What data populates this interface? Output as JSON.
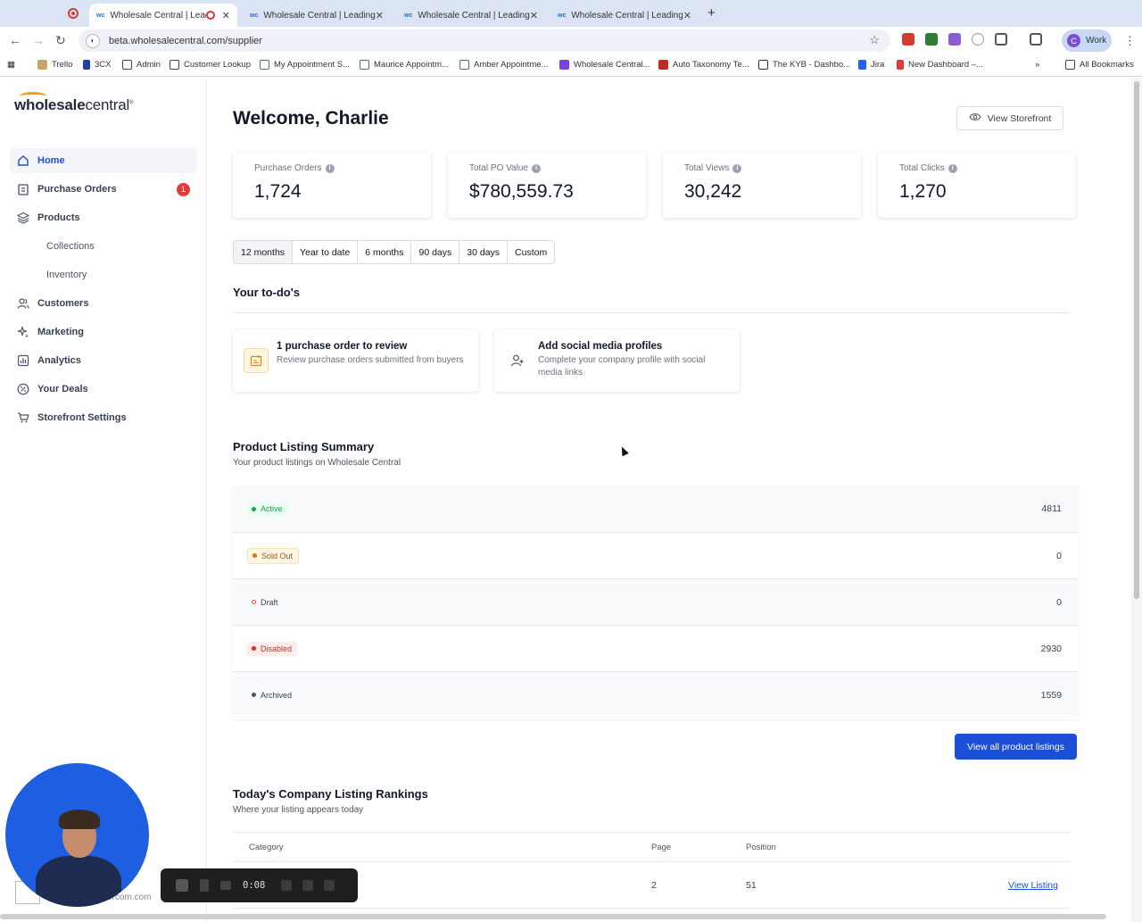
{
  "browser": {
    "tabs": [
      {
        "title": "Wholesale Central | Lead",
        "active": true,
        "recording": true
      },
      {
        "title": "Wholesale Central | Leading",
        "active": false
      },
      {
        "title": "Wholesale Central | Leading",
        "active": false
      },
      {
        "title": "Wholesale Central | Leading",
        "active": false
      }
    ],
    "url": "beta.wholesalecentral.com/supplier",
    "profile_label": "Work",
    "profile_initial": "C",
    "bookmarks": [
      "Trello",
      "3CX",
      "Admin",
      "Customer Lookup",
      "My Appointment S...",
      "Maurice Appointm...",
      "Amber Appointme...",
      "Wholesale Central...",
      "Auto Taxonomy Te...",
      "The KYB - Dashbo...",
      "Jira",
      "New Dashboard –..."
    ],
    "all_bookmarks_label": "All Bookmarks"
  },
  "sidebar": {
    "logo_bold": "wholesale",
    "logo_light": "central",
    "items": [
      {
        "label": "Home",
        "icon": "home-icon",
        "active": true
      },
      {
        "label": "Purchase Orders",
        "icon": "clipboard-icon",
        "badge": "1"
      },
      {
        "label": "Products",
        "icon": "layers-icon"
      },
      {
        "label": "Collections",
        "sub": true
      },
      {
        "label": "Inventory",
        "sub": true
      },
      {
        "label": "Customers",
        "icon": "users-icon"
      },
      {
        "label": "Marketing",
        "icon": "sparkle-icon"
      },
      {
        "label": "Analytics",
        "icon": "bar-chart-icon"
      },
      {
        "label": "Your Deals",
        "icon": "percent-icon"
      },
      {
        "label": "Storefront Settings",
        "icon": "cart-icon"
      }
    ]
  },
  "header": {
    "welcome": "Welcome, Charlie",
    "view_storefront": "View Storefront"
  },
  "stats": [
    {
      "label": "Purchase Orders",
      "value": "1,724"
    },
    {
      "label": "Total PO Value",
      "value": "$780,559.73"
    },
    {
      "label": "Total Views",
      "value": "30,242"
    },
    {
      "label": "Total Clicks",
      "value": "1,270"
    }
  ],
  "ranges": [
    "12 months",
    "Year to date",
    "6 months",
    "90 days",
    "30 days",
    "Custom"
  ],
  "todos": {
    "title": "Your to-do's",
    "items": [
      {
        "title": "1 purchase order to review",
        "desc": "Review purchase orders submitted from buyers",
        "icon": "review-icon"
      },
      {
        "title": "Add social media profiles",
        "desc": "Complete your company profile with social media links",
        "icon": "add-user-icon"
      }
    ]
  },
  "listing_summary": {
    "title": "Product Listing Summary",
    "subtitle": "Your product listings on Wholesale Central",
    "rows": [
      {
        "status": "Active",
        "count": "4811",
        "color": "#16a34a",
        "bg": "#ecfdf3"
      },
      {
        "status": "Sold Out",
        "count": "0",
        "color": "#d97706",
        "bg": "#fff7e6"
      },
      {
        "status": "Draft",
        "count": "0",
        "color": "#ef4444",
        "bg": "#ffffff"
      },
      {
        "status": "Disabled",
        "count": "2930",
        "color": "#dc2626",
        "bg": "#fdecec"
      },
      {
        "status": "Archived",
        "count": "1559",
        "color": "#4b5563",
        "bg": "#f3f4f6"
      }
    ],
    "view_all": "View all product listings"
  },
  "rankings": {
    "title": "Today's Company Listing Rankings",
    "subtitle": "Where your listing appears today",
    "columns": [
      "Category",
      "Page",
      "Position"
    ],
    "rows": [
      {
        "category": "",
        "page": "2",
        "position": "51",
        "action": "View Listing"
      }
    ]
  },
  "recorder": {
    "time": "0:08",
    "footer_text": "ercom.com"
  },
  "colors": {
    "accent": "#1d4ed8",
    "badge": "#e53935",
    "logo_arc": "#f0a11a"
  }
}
